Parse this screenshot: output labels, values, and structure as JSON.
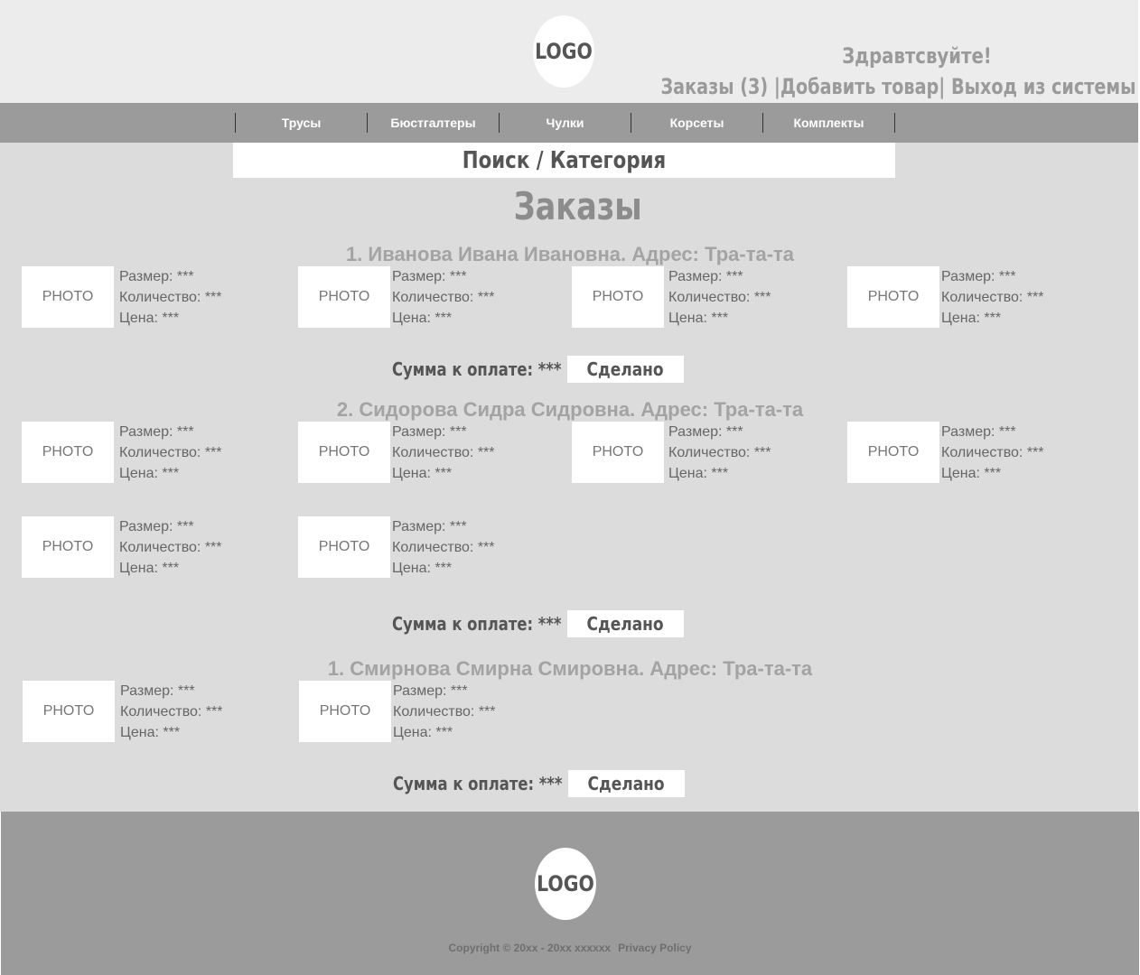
{
  "header": {
    "logo": "LOGO",
    "greeting": "Здравтсвуйте!",
    "orders_link": "Заказы (3)",
    "separator1": " |",
    "add_product_link": "Добавить товар",
    "separator2": "| ",
    "logout_link": "Выход из системы"
  },
  "nav": {
    "items": [
      "Трусы",
      "Бюстгалтеры",
      "Чулки",
      "Корсеты",
      "Комплекты"
    ]
  },
  "search": {
    "label": "Поиск / Категория"
  },
  "page_title": "Заказы",
  "orders": [
    {
      "title": "1. Иванова Ивана Ивановна. Адрес: Тра-та-та",
      "items": [
        {
          "photo": "PHOTO",
          "size": "Размер: ***",
          "qty": "Количество: ***",
          "price": "Цена: ***"
        },
        {
          "photo": "PHOTO",
          "size": "Размер: ***",
          "qty": "Количество: ***",
          "price": "Цена: ***"
        },
        {
          "photo": "PHOTO",
          "size": "Размер: ***",
          "qty": "Количество: ***",
          "price": "Цена: ***"
        },
        {
          "photo": "PHOTO",
          "size": "Размер: ***",
          "qty": "Количество: ***",
          "price": "Цена: ***"
        }
      ],
      "sum": "Сумма к оплате: ***",
      "done": "Сделано"
    },
    {
      "title": "2. Сидорова Сидра Сидровна. Адрес: Тра-та-та",
      "items": [
        {
          "photo": "PHOTO",
          "size": "Размер: ***",
          "qty": "Количество: ***",
          "price": "Цена: ***"
        },
        {
          "photo": "PHOTO",
          "size": "Размер: ***",
          "qty": "Количество: ***",
          "price": "Цена: ***"
        },
        {
          "photo": "PHOTO",
          "size": "Размер: ***",
          "qty": "Количество: ***",
          "price": "Цена: ***"
        },
        {
          "photo": "PHOTO",
          "size": "Размер: ***",
          "qty": "Количество: ***",
          "price": "Цена: ***"
        },
        {
          "photo": "PHOTO",
          "size": "Размер: ***",
          "qty": "Количество: ***",
          "price": "Цена: ***"
        },
        {
          "photo": "PHOTO",
          "size": "Размер: ***",
          "qty": "Количество: ***",
          "price": "Цена: ***"
        }
      ],
      "sum": "Сумма к оплате: ***",
      "done": "Сделано"
    },
    {
      "title": "1. Смирнова Смирна Смировна. Адрес: Тра-та-та",
      "items": [
        {
          "photo": "PHOTO",
          "size": "Размер: ***",
          "qty": "Количество: ***",
          "price": "Цена: ***"
        },
        {
          "photo": "PHOTO",
          "size": "Размер: ***",
          "qty": "Количество: ***",
          "price": "Цена: ***"
        }
      ],
      "sum": "Сумма к оплате: ***",
      "done": "Сделано"
    }
  ],
  "footer": {
    "logo": "LOGO",
    "copyright": "Copyright © 20xx - 20xx xxxxxx",
    "privacy": "Privacy Policy"
  },
  "colors": {
    "header_bg": "#ececec",
    "nav_bg": "#9b9b9b",
    "main_bg": "#dcdcdc",
    "footer_bg": "#9b9b9b"
  }
}
